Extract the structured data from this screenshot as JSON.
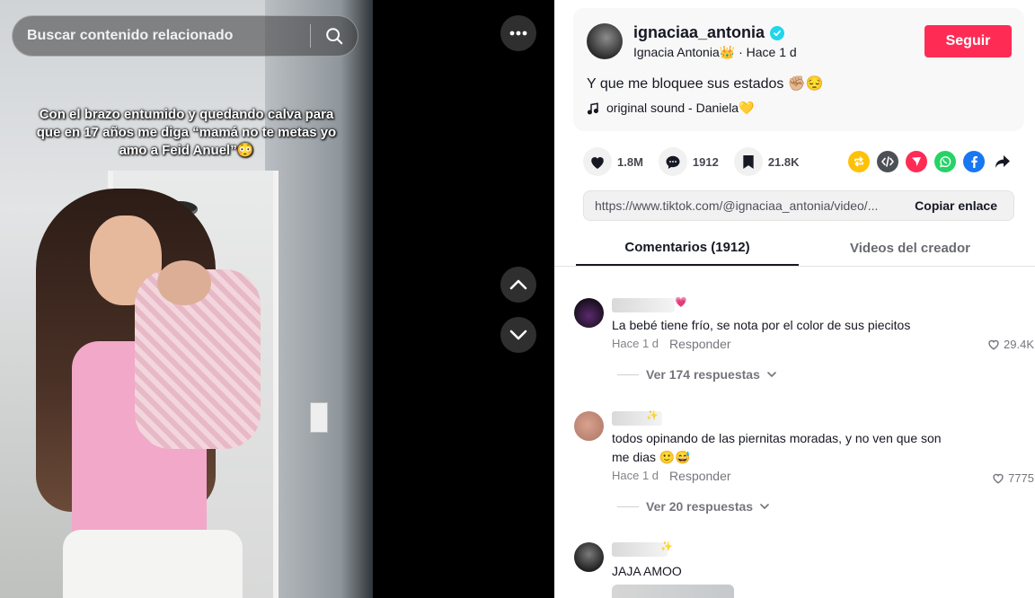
{
  "search": {
    "placeholder": "Buscar contenido relacionado"
  },
  "video": {
    "caption": "Con el brazo entumido y quedando calva para que en 17 años me diga “mamá no te metas yo amo a Feid Anuel”😳"
  },
  "author": {
    "username": "ignaciaa_antonia",
    "subline": "Ignacia Antonia👑 · Hace 1 d",
    "follow_label": "Seguir",
    "description": "Y que me bloquee sus estados ✊🏼😔",
    "sound": "original sound - Daniela💛"
  },
  "stats": {
    "likes": "1.8M",
    "comments": "1912",
    "saves": "21.8K"
  },
  "share": {
    "link": "https://www.tiktok.com/@ignaciaa_antonia/video/...",
    "copy_label": "Copiar enlace",
    "icons": [
      "repost-icon",
      "embed-icon",
      "direct-message-icon",
      "whatsapp-icon",
      "facebook-icon",
      "share-arrow-icon"
    ]
  },
  "tabs": [
    {
      "label": "Comentarios (1912)",
      "active": true
    },
    {
      "label": "Videos del creador",
      "active": false
    }
  ],
  "comments": [
    {
      "name_emoji": "💗",
      "text": "La bebé tiene frío, se nota por el color de sus piecitos",
      "time": "Hace 1 d",
      "reply_label": "Responder",
      "likes": "29.4K",
      "replies_label": "Ver 174 respuestas"
    },
    {
      "name_emoji": "✨",
      "text": "todos opinando de las piernitas moradas, y no ven que son me dias 🙂😅",
      "time": "Hace 1 d",
      "reply_label": "Responder",
      "likes": "7775",
      "replies_label": "Ver 20 respuestas"
    },
    {
      "name_emoji": "✨",
      "text": "JAJA AMOO"
    }
  ],
  "colors": {
    "accent": "#fe2c55",
    "verified": "#20d5ec",
    "text": "#161823"
  }
}
